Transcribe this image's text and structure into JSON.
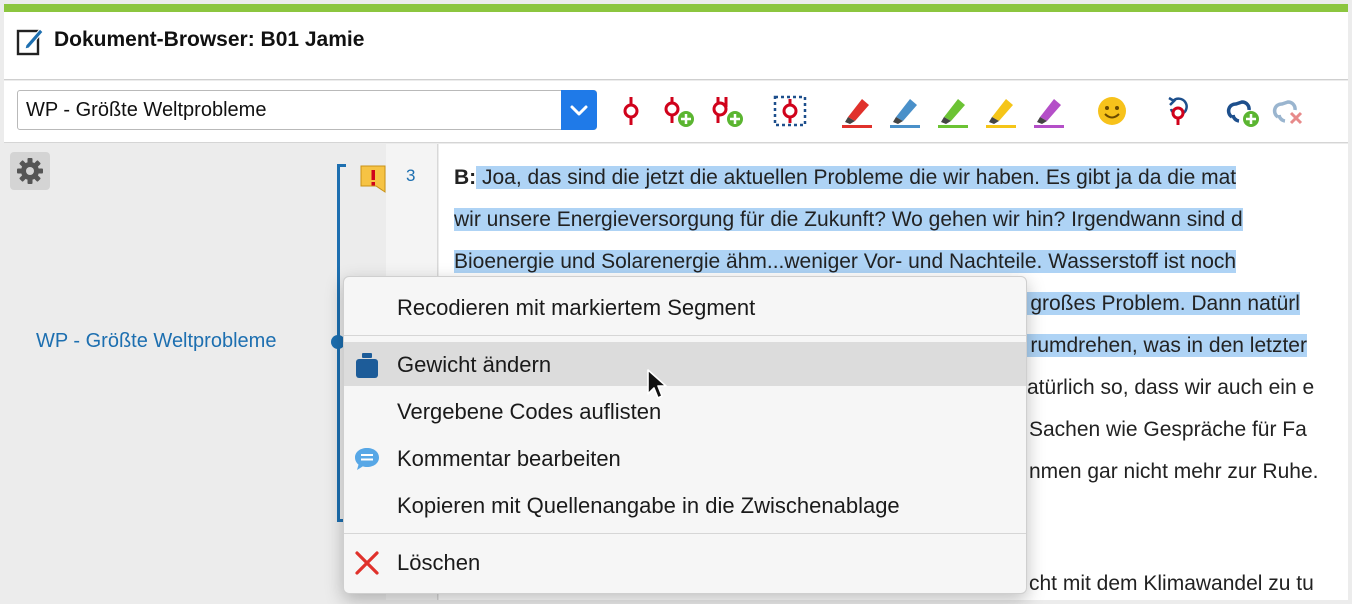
{
  "window": {
    "title": "Dokument-Browser: B01 Jamie"
  },
  "toolbar": {
    "code_select_value": "WP - Größte Weltprobleme",
    "icons": [
      "code-icon",
      "add-code-icon",
      "add-subcode-icon",
      "code-selection-icon",
      "red-highlighter-icon",
      "blue-highlighter-icon",
      "green-highlighter-icon",
      "yellow-highlighter-icon",
      "purple-highlighter-icon",
      "emoticon-icon",
      "undo-code-icon",
      "add-link-icon",
      "remove-link-icon"
    ]
  },
  "sidepanel": {
    "code_label": "WP - Größte Weltprobleme"
  },
  "gutter": {
    "line_number": "3"
  },
  "document": {
    "speaker": "B:",
    "lines": [
      " Joa, das sind die jetzt die aktuellen Probleme die wir haben. Es gibt ja da die mat",
      "wir unsere Energieversorgung für die Zukunft? Wo gehen wir hin? Irgendwann sind d",
      "Bioenergie und Solarenergie ähm...weniger Vor- und Nachteile. Wasserstoff ist noch",
      "z großes Problem. Dann natürl",
      "s rumdrehen, was in den letzter",
      "atürlich so, dass wir auch ein e",
      "Sachen wie Gespräche für Fa",
      "nmen gar nicht mehr zur Ruhe.",
      "cht mit dem Klimawandel zu tu"
    ]
  },
  "context_menu": {
    "items": [
      {
        "label": "Recodieren mit markiertem Segment",
        "icon": ""
      },
      {
        "label": "Gewicht ändern",
        "icon": "weight-icon"
      },
      {
        "label": "Vergebene Codes auflisten",
        "icon": ""
      },
      {
        "label": "Kommentar bearbeiten",
        "icon": "comment-icon"
      },
      {
        "label": "Kopieren mit Quellenangabe in die Zwischenablage",
        "icon": ""
      },
      {
        "label": "Löschen",
        "icon": "delete-icon"
      }
    ]
  },
  "colors": {
    "accent_green": "#8cc63f",
    "code_blue": "#1d6fb0",
    "highlight": "#aed3f5",
    "select_arrow": "#1f7ae8",
    "delete_red": "#e0312b"
  }
}
